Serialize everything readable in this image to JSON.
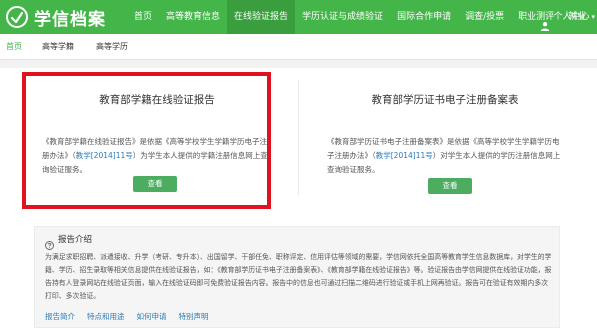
{
  "header": {
    "logo_text": "学信档案",
    "brand_color": "#44b549",
    "nav": [
      "首页",
      "高等教育信息",
      "在线验证报告",
      "学历认证与成绩验证",
      "国际合作申请",
      "调查/投票",
      "职业测评",
      "就业"
    ],
    "active_nav": "在线验证报告",
    "user_menu": "个人中心",
    "user_icon": "user-icon"
  },
  "subnav": {
    "home": "首页",
    "tabs": [
      "高等学籍",
      "高等学历"
    ]
  },
  "cards": {
    "left": {
      "title": "教育部学籍在线验证报告",
      "desc_before": "《教育部学籍在线验证报告》是依据《高等学校学生学籍学历电子注册办法》（",
      "desc_link": "教学[2014]11号",
      "desc_after": "）为学生本人提供的学籍注册信息网上查询验证服务。",
      "button": "查看"
    },
    "right": {
      "title": "教育部学历证书电子注册备案表",
      "desc_before": "《教育部学历证书电子注册备案表》是依据《高等学校学生学籍学历电子注册办法》（",
      "desc_link": "教学[2014]11号",
      "desc_after": "）对学生本人提供的学历注册信息网上查询验证服务。",
      "button": "查看"
    }
  },
  "intro": {
    "title": "报告介绍",
    "icon": "help-circle-icon",
    "body": "为满足求职招聘、派遣接收、升学（考研、专升本）、出国留学、干部任免、职称评定、信用评估等领域的需要，学信网依托全国高等教育学生信息数据库，对学生的学籍、学历、招生录取等相关信息提供在线验证报告，如：《教育部学历证书电子注册备案表》、《教育部学籍在线验证报告》等。验证报告由学信网提供在线验证功能，报告持有人登录网站在线验证页面，输入在线验证码即可免费验证报告内容。报告中的信息也可通过扫描二维码进行验证或手机上网再验证。报告可在验证有效期内多次打印、多次验证。",
    "links": [
      "报告简介",
      "特点和用途",
      "如何申请",
      "特别声明"
    ]
  }
}
